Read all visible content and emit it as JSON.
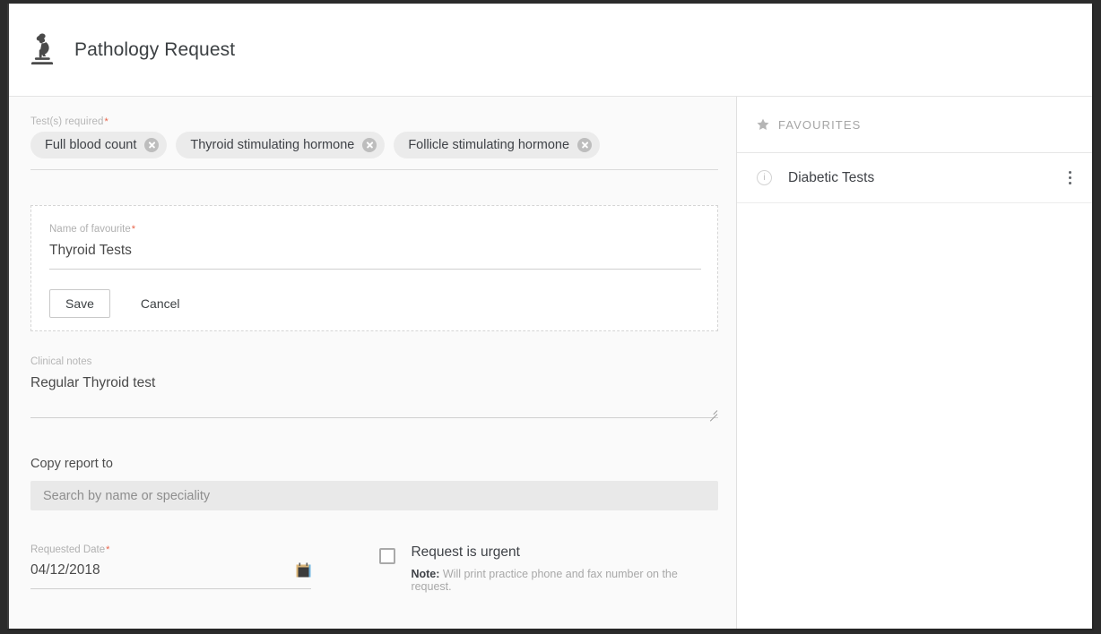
{
  "header": {
    "icon": "microscope-icon",
    "title": "Pathology Request"
  },
  "form": {
    "tests_required": {
      "label": "Test(s) required",
      "required_marker": "*",
      "chips": [
        {
          "label": "Full blood count",
          "remove_icon": "close-circle-icon"
        },
        {
          "label": "Thyroid stimulating hormone",
          "remove_icon": "close-circle-icon"
        },
        {
          "label": "Follicle stimulating hormone",
          "remove_icon": "close-circle-icon"
        }
      ]
    },
    "favourite_card": {
      "name_label": "Name of favourite",
      "required_marker": "*",
      "name_value": "Thyroid Tests",
      "save_label": "Save",
      "cancel_label": "Cancel"
    },
    "clinical_notes": {
      "label": "Clinical notes",
      "value": "Regular Thyroid test",
      "resize_handle": "resize-grip-icon"
    },
    "copy_report_to": {
      "label": "Copy report to",
      "placeholder": "Search by name or speciality",
      "value": ""
    },
    "requested_date": {
      "label": "Requested Date",
      "required_marker": "*",
      "value": "04/12/2018",
      "picker_icon": "calendar-icon"
    },
    "urgent": {
      "label": "Request is urgent",
      "checked": false,
      "note_prefix": "Note:",
      "note_text": "Will print practice phone and fax number on the request."
    }
  },
  "sidebar": {
    "header": {
      "icon": "star-icon",
      "label": "FAVOURITES"
    },
    "items": [
      {
        "info_icon": "info-circle-icon",
        "label": "Diabetic Tests",
        "menu_icon": "more-vertical-icon"
      }
    ]
  },
  "colors": {
    "accent_required": "#e8634a",
    "panel_background": "#fafafa",
    "sidebar_background": "#ffffff",
    "chip_background": "#ebebeb",
    "search_background": "#e9e9e9",
    "text_primary": "#3f4247",
    "text_muted": "#b0b0b0"
  }
}
